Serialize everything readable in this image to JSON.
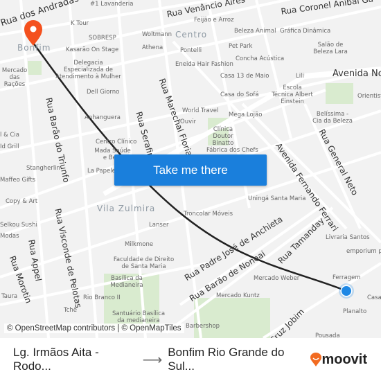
{
  "map": {
    "streets": [
      "Rua dos Andradas",
      "Rua Venâncio Aires",
      "Rua Coronel Aníbal Ga",
      "Avenida Nos",
      "Rua Barão do Triunfo",
      "Rua Visconde de Pelotas",
      "Rua Marechal Floriano",
      "Rua Serafim",
      "Avenida Fernando Ferrari",
      "Rua General Neto",
      "Rua Padre José de Anchieta",
      "Rua Barão de Nonoai",
      "Rua Tamanday",
      "Rua Appel",
      "Rua Morotin",
      "Cruz Jobim"
    ],
    "neighborhoods": [
      "Centro",
      "Bonfim",
      "Vila Zulmira"
    ],
    "places": [
      "#1 Lavanderia",
      "K Tour",
      "SOBRESP",
      "Woltmann",
      "Athena",
      "Kasarão On Stage",
      "Feijão e Arroz",
      "Beleza Animal",
      "Gráfica Dinâmica",
      "Pet Park",
      "Pontelli",
      "Concha Acústica",
      "Salão de Beleza Lara",
      "Eneida Hair Fashion",
      "Casa 13 de Maio",
      "Lili",
      "Delegacia Especializada de Atendimento à Mulher",
      "Mercado das Rações",
      "Dell Giorno",
      "Casa do Sofá",
      "Escola Técnica Albert Einstein",
      "Orientist",
      "Anhanguera",
      "World Travel",
      "Mega Lojão",
      "Belíssima - Cia da Beleza",
      "Ouvir",
      "Clínica Doutor Binatto",
      "Centro Clínico",
      "Mada Saúde e Bem",
      "Fábrica dos Chefs",
      "Stangherlin",
      "La Papeleria",
      "Maffeo Gifts",
      "Copy & Art",
      "Uningá Santa Maria",
      "Troncolar Móveis",
      "Selkou Sushi",
      "Modas",
      "Lanser",
      "Livraria Santos",
      "emporium pa",
      "Milkmone",
      "Faculdade de Direito de Santa Maria",
      "Basílica da Medianeira",
      "Mercado Weber",
      "Ferragem",
      "Casa",
      "Mercado Kuntz",
      "Rio Branco II",
      "Tchê",
      "Santuário Basílica da medianeira",
      "Planalto",
      "Pousada",
      "Taura",
      "Barbershop",
      "Id Grill",
      "l & Cia"
    ],
    "origin_color": "#1e88e5",
    "destination_color": "#f4511e",
    "route_color": "#222222"
  },
  "cta": {
    "label": "Take me there"
  },
  "attribution": "© OpenStreetMap contributors | © OpenMapTiles",
  "footer": {
    "from": "Lg. Irmãos Aita - Rodo...",
    "arrow": "⟶",
    "to": "Bonfim Rio Grande do Sul...",
    "brand": "moovit",
    "brand_color": "#f26b21"
  }
}
